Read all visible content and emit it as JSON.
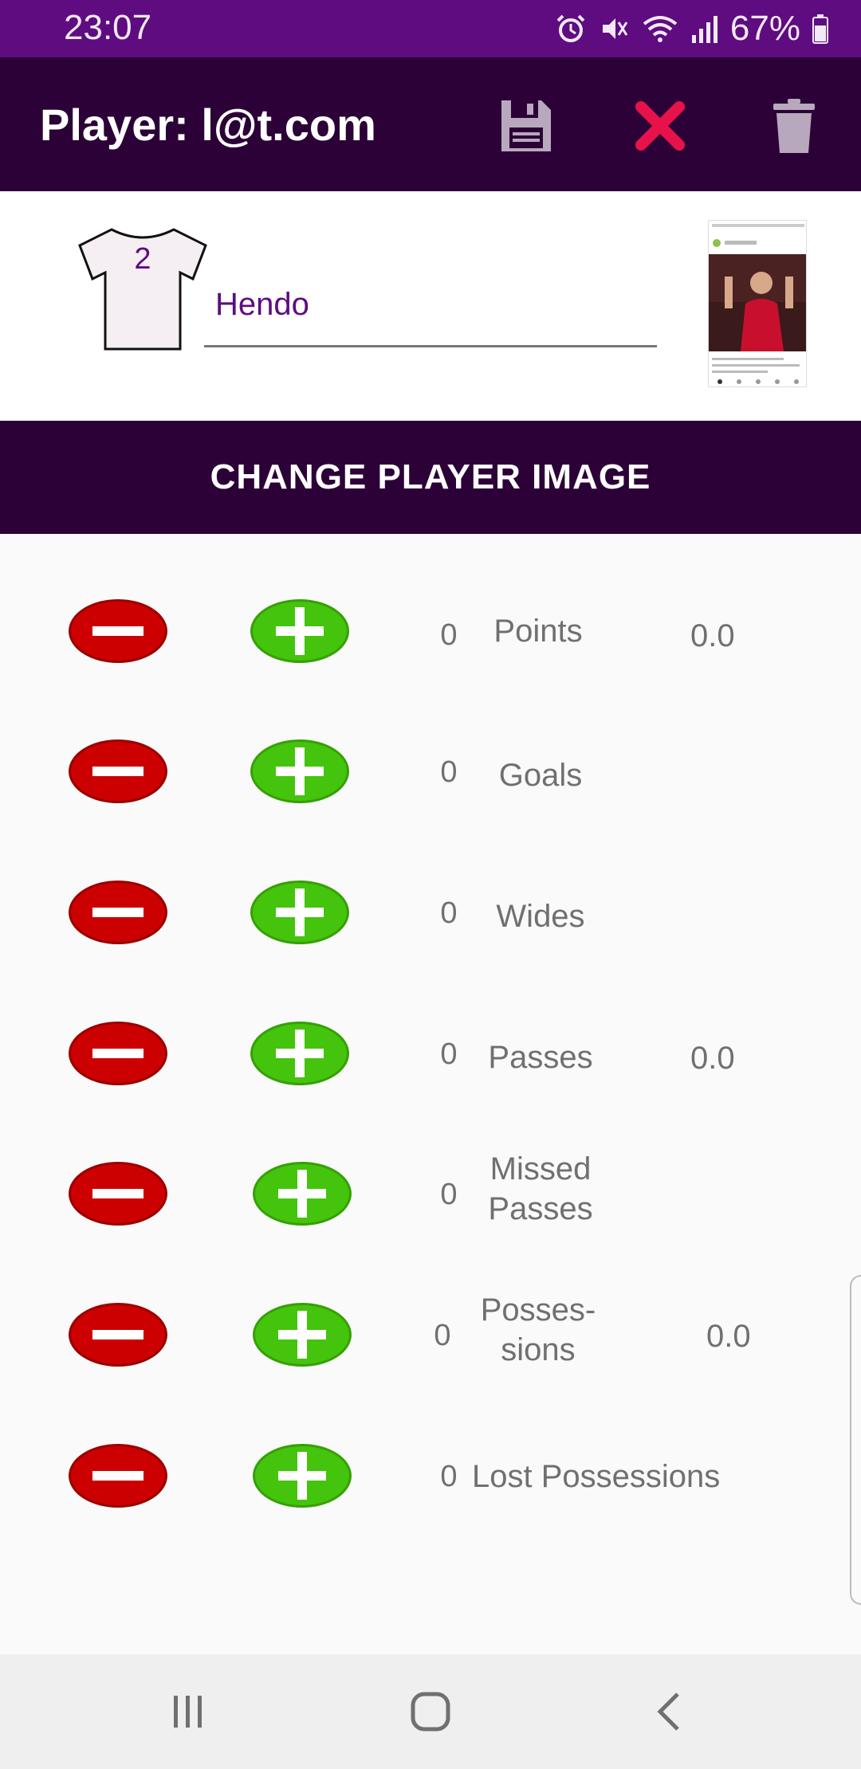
{
  "status_bar": {
    "time": "23:07",
    "battery_text": "67%",
    "icons": [
      "alarm-icon",
      "mute-icon",
      "wifi-icon",
      "signal-icon",
      "battery-icon"
    ]
  },
  "app_bar": {
    "title": "Player: l@t.com",
    "actions": [
      "save-icon",
      "close-icon",
      "delete-icon"
    ],
    "close_color": "#e8124a"
  },
  "player": {
    "jersey_number": "2",
    "name": "Hendo"
  },
  "change_image_label": "CHANGE PLAYER IMAGE",
  "stats": [
    {
      "count": "0",
      "label": "Points",
      "ratio": "0.0"
    },
    {
      "count": "0",
      "label": "Goals",
      "ratio": ""
    },
    {
      "count": "0",
      "label": "Wides",
      "ratio": ""
    },
    {
      "count": "0",
      "label": "Passes",
      "ratio": "0.0"
    },
    {
      "count": "0",
      "label_line1": "Missed",
      "label_line2": "Passes",
      "ratio": ""
    },
    {
      "count": "0",
      "label_line1": "Posses-",
      "label_line2": "sions",
      "ratio": "0.0"
    },
    {
      "count": "0",
      "label": "Lost Possessions",
      "ratio": ""
    }
  ],
  "nav_bar": {
    "buttons": [
      "recents-icon",
      "home-icon",
      "back-icon"
    ]
  },
  "colors": {
    "status_bar": "#5e0c80",
    "app_bar": "#2c0137",
    "minus_button": "#cc0000",
    "plus_button": "#44c40c",
    "accent_text": "#5e0c80"
  }
}
